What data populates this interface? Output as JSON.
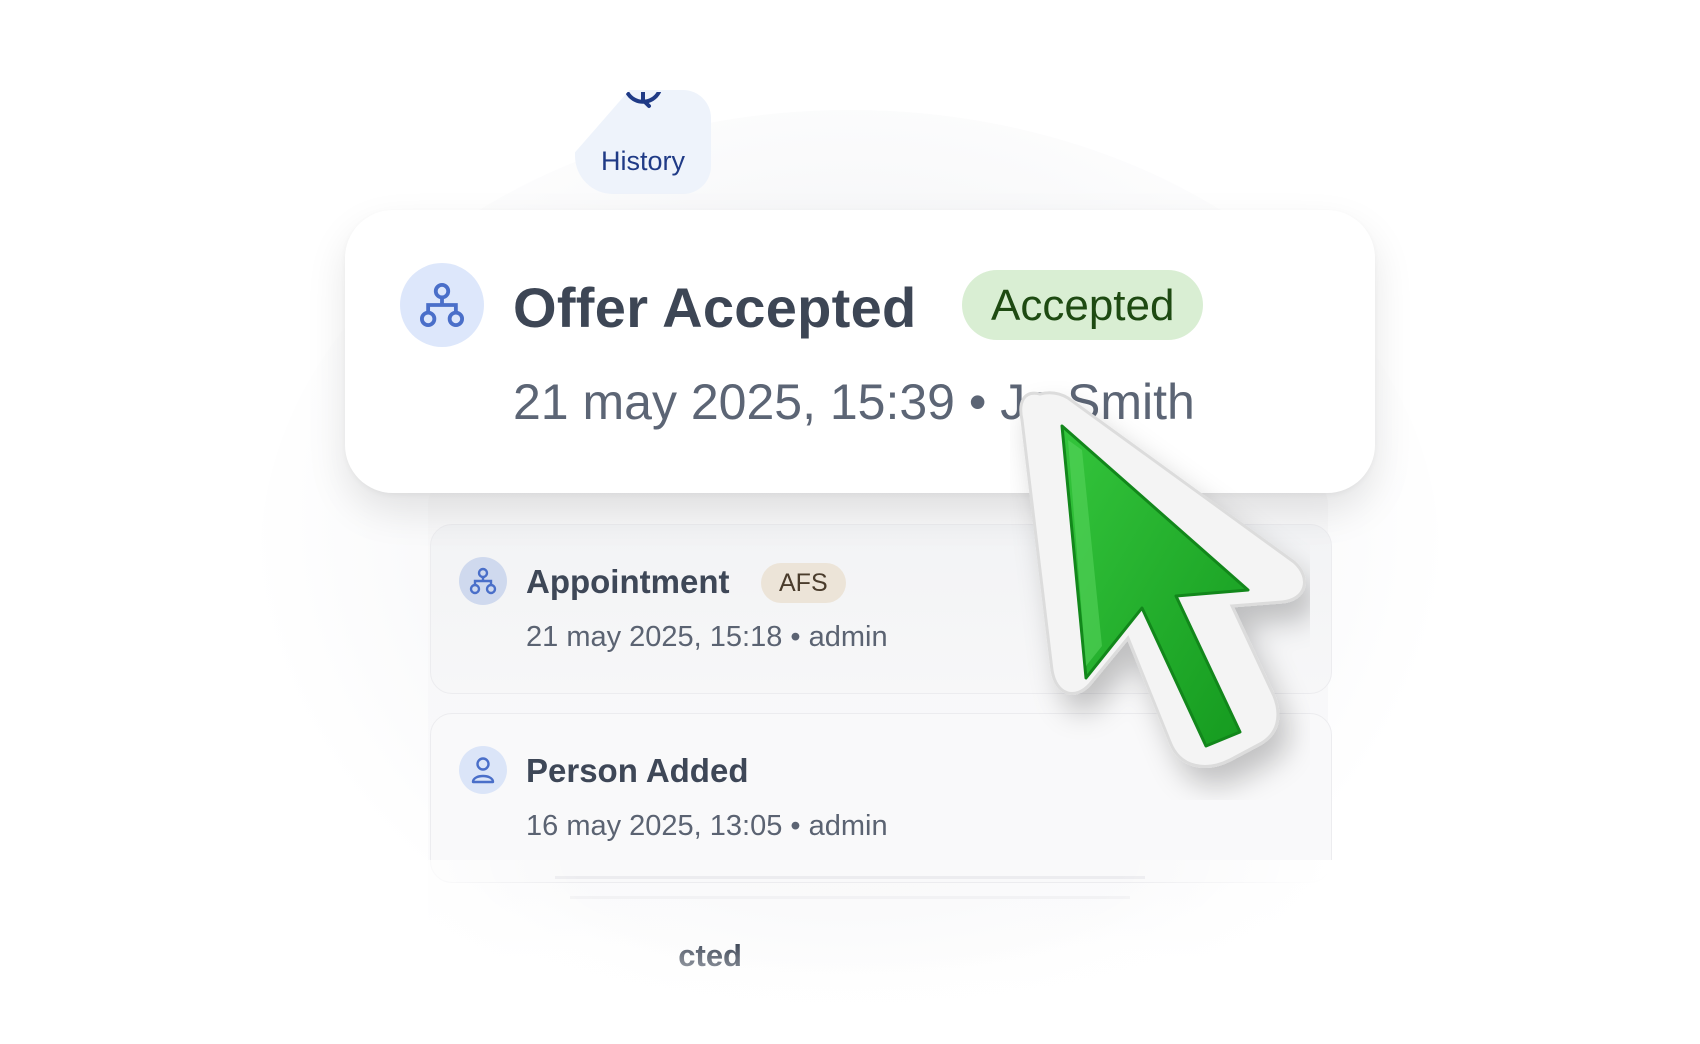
{
  "history_tab": {
    "label": "History",
    "icon": "clock-icon"
  },
  "main_event": {
    "title": "Offer Accepted",
    "status": "Accepted",
    "meta": "21 may 2025, 15:39 • Je   Smith",
    "icon": "workflow-icon",
    "status_color": "#d9eed3"
  },
  "events": [
    {
      "title": "Appointment",
      "badge": "AFS",
      "meta": "21 may 2025, 15:18 • admin",
      "icon": "workflow-icon"
    },
    {
      "title": "Person Added",
      "meta": "16 may 2025, 13:05 • admin",
      "icon": "person-icon"
    }
  ],
  "partial_event": {
    "title_fragment": "cted"
  },
  "cursor": {
    "icon": "pointer-cursor-icon",
    "color": "#1fae2a"
  }
}
